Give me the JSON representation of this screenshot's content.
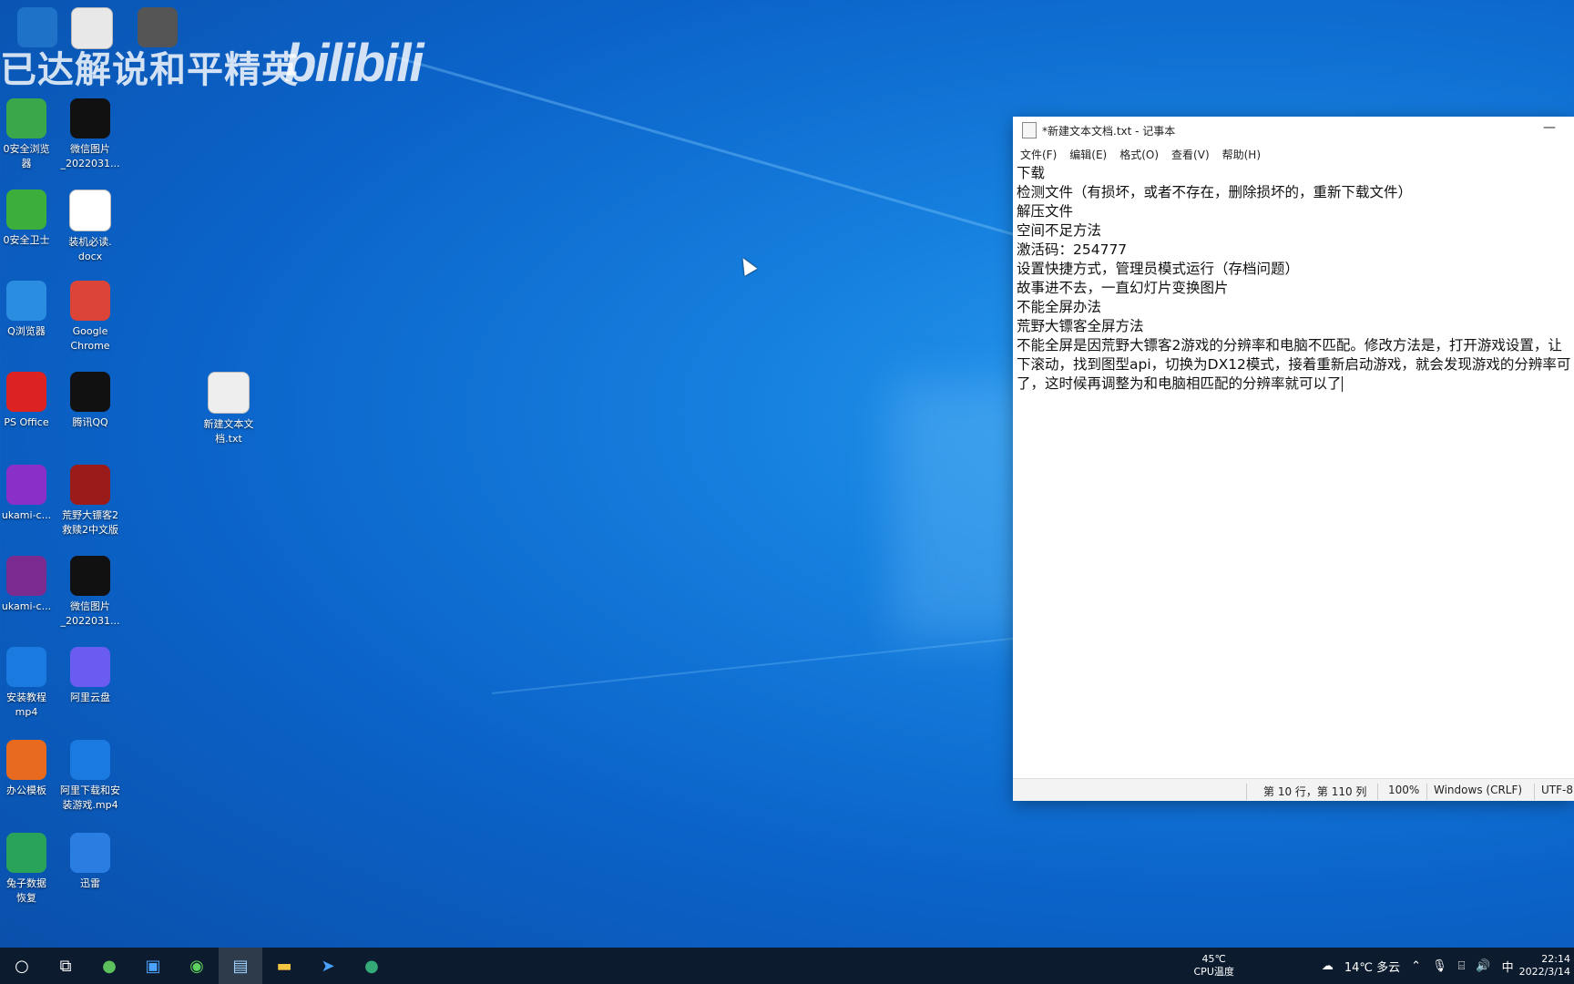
{
  "watermark": {
    "text": "已达解说和平精英",
    "logo": "bilibili"
  },
  "desktop_icons": [
    {
      "label": "",
      "icon": "app-icon",
      "color": "#1e73c8"
    },
    {
      "label": "",
      "icon": "document-icon",
      "color": "#e8e8e8"
    },
    {
      "label": "",
      "icon": "image-icon",
      "color": "#555"
    },
    {
      "label": "0安全浏览\n器",
      "icon": "browser-360-icon",
      "color": "#3aa84a"
    },
    {
      "label": "微信图片\n_2022031...",
      "icon": "image-file-icon",
      "color": "#111"
    },
    {
      "label": "0安全卫士",
      "icon": "security-360-icon",
      "color": "#3cae3c"
    },
    {
      "label": "装机必读.\ndocx",
      "icon": "word-document-icon",
      "color": "#ffffff"
    },
    {
      "label": "Q浏览器",
      "icon": "qq-browser-icon",
      "color": "#2a8de0"
    },
    {
      "label": "Google\nChrome",
      "icon": "chrome-icon",
      "color": "#db4437"
    },
    {
      "label": "PS Office",
      "icon": "wps-office-icon",
      "color": "#d22"
    },
    {
      "label": "腾讯QQ",
      "icon": "qq-icon",
      "color": "#111"
    },
    {
      "label": "新建文本文\n档.txt",
      "icon": "text-file-icon",
      "color": "#eeeeee"
    },
    {
      "label": "ukami-c...",
      "icon": "yukami-icon",
      "color": "#8b2fc9"
    },
    {
      "label": "荒野大镖客2\n救赎2中文版",
      "icon": "rdr2-game-icon",
      "color": "#9b1b1b"
    },
    {
      "label": "ukami-c...",
      "icon": "winrar-icon",
      "color": "#7a2b8f"
    },
    {
      "label": "微信图片\n_2022031...",
      "icon": "image-file-icon",
      "color": "#111"
    },
    {
      "label": "安装教程\nmp4",
      "icon": "video-file-icon",
      "color": "#1a7ae0"
    },
    {
      "label": "阿里云盘",
      "icon": "aliyun-drive-icon",
      "color": "#6a5cf0"
    },
    {
      "label": "办公模板",
      "icon": "office-template-icon",
      "color": "#e86a1e"
    },
    {
      "label": "阿里下载和安\n装游戏.mp4",
      "icon": "video-file-icon",
      "color": "#1a7ae0"
    },
    {
      "label": "兔子数据\n恢复",
      "icon": "rabbit-recovery-icon",
      "color": "#2aa35a"
    },
    {
      "label": "迅雷",
      "icon": "xunlei-icon",
      "color": "#2a7de1"
    }
  ],
  "notepad": {
    "title": "*新建文本文档.txt - 记事本",
    "menu": [
      "文件(F)",
      "编辑(E)",
      "格式(O)",
      "查看(V)",
      "帮助(H)"
    ],
    "lines": [
      "下载",
      "检测文件（有损坏，或者不存在，删除损坏的，重新下载文件）",
      "解压文件",
      "空间不足方法",
      "激活码：254777",
      "设置快捷方式，管理员模式运行（存档问题）",
      "故事进不去，一直幻灯片变换图片",
      "不能全屏办法",
      "荒野大镖客全屏方法",
      "不能全屏是因荒野大镖客2游戏的分辨率和电脑不匹配。修改方法是，打开游戏设置，让",
      "下滚动，找到图型api，切换为DX12模式，接着重新启动游戏，就会发现游戏的分辨率可",
      "了，这时候再调整为和电脑相匹配的分辨率就可以了"
    ],
    "status": {
      "position": "第 10 行，第 110 列",
      "zoom": "100%",
      "line_ending": "Windows (CRLF)",
      "encoding": "UTF-8"
    }
  },
  "taskbar": {
    "cpu_temp": "45℃",
    "cpu_label": "CPU温度",
    "weather": "14℃ 多云",
    "ime": "中",
    "time": "22:14",
    "date": "2022/3/14"
  }
}
